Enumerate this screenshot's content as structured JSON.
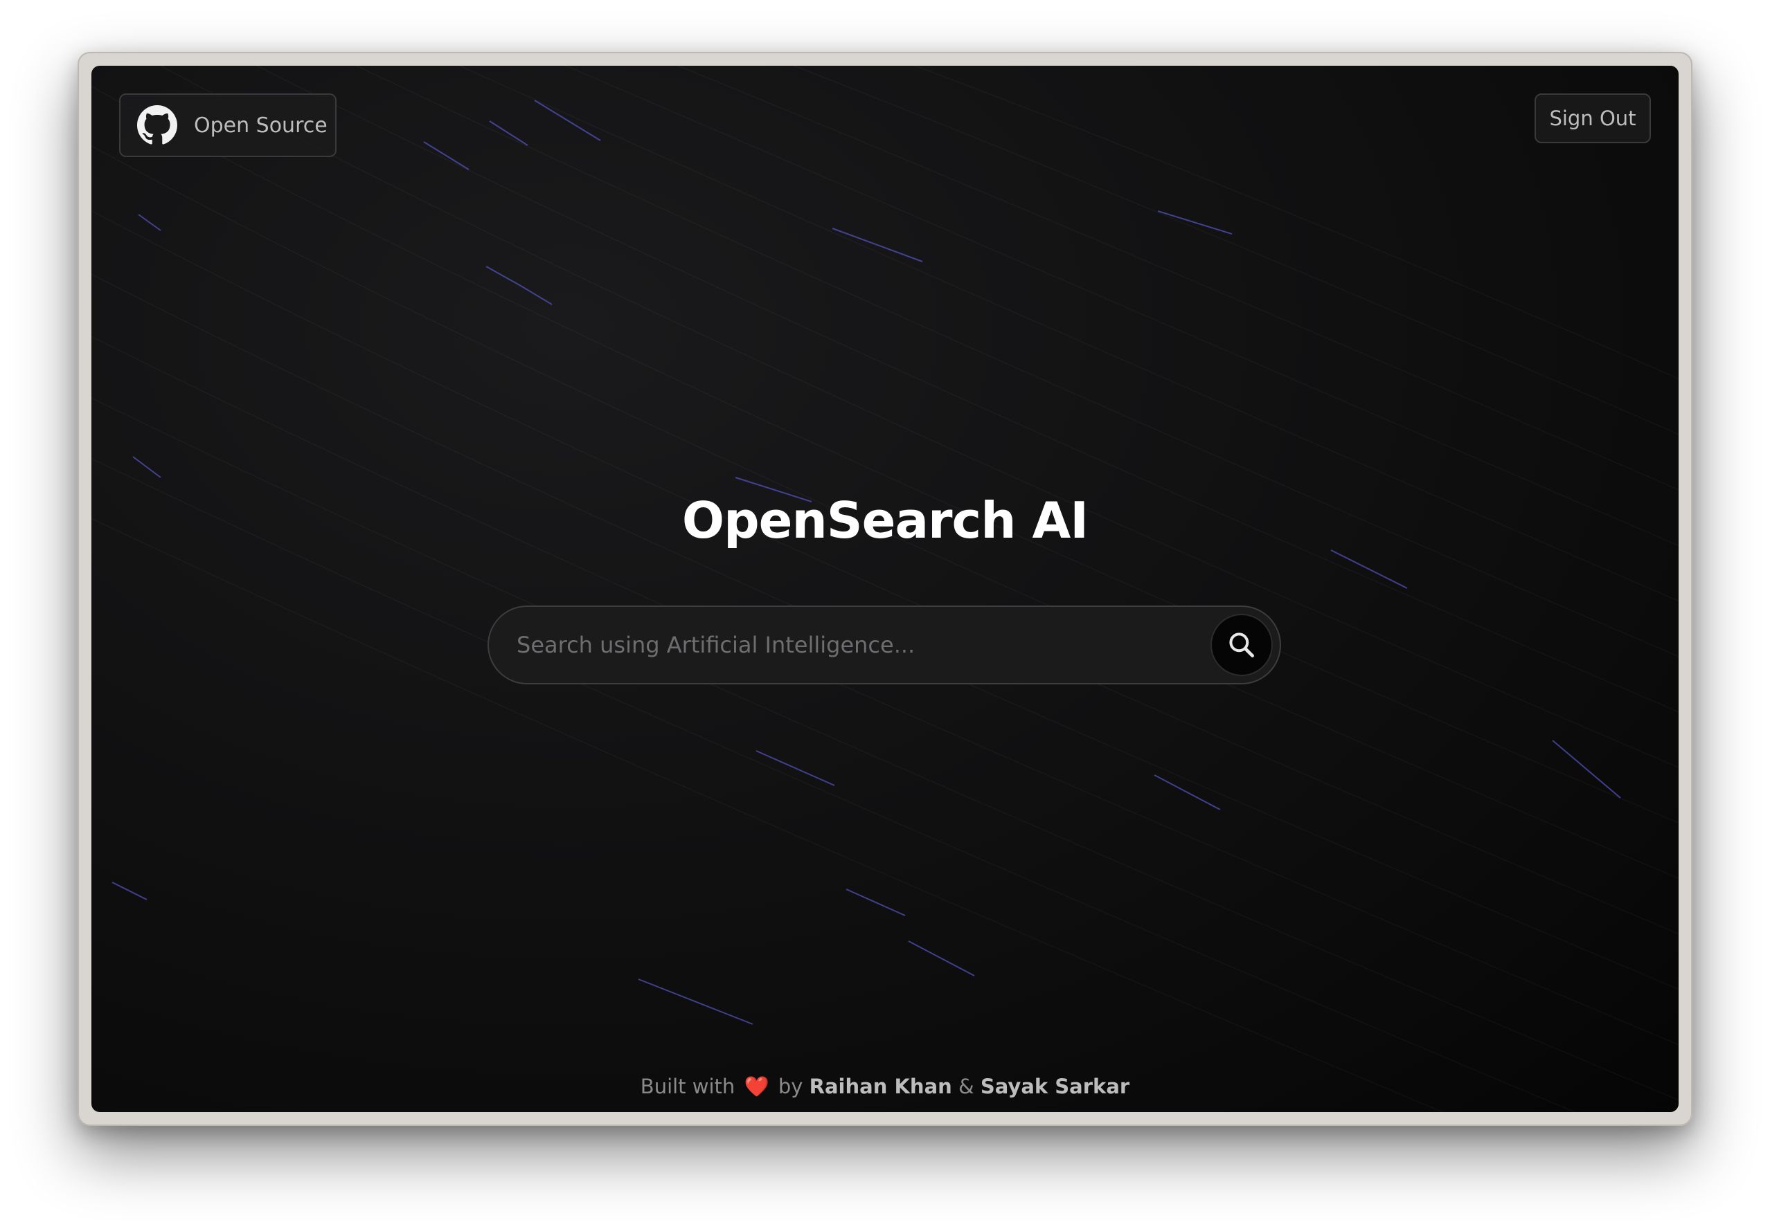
{
  "header": {
    "open_source_label": "Open Source",
    "sign_out_label": "Sign Out",
    "github_icon": "github-icon"
  },
  "main": {
    "title": "OpenSearch AI",
    "search": {
      "placeholder": "Search using Artificial Intelligence...",
      "value": "",
      "button_icon": "search-icon"
    }
  },
  "footer": {
    "built_with": "Built with",
    "heart": "❤️",
    "by": "by",
    "author1": "Raihan Khan",
    "amp": "&",
    "author2": "Sayak Sarkar"
  },
  "colors": {
    "background": "#111112",
    "accent_streak": "#4b4ba8",
    "heart": "#e53935"
  }
}
